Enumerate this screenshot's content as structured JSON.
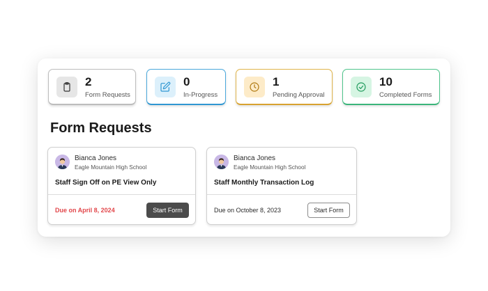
{
  "stats": [
    {
      "value": "2",
      "label": "Form Requests",
      "icon": "clipboard-icon",
      "color": "#bdbdbd"
    },
    {
      "value": "0",
      "label": "In-Progress",
      "icon": "edit-icon",
      "color": "#2f97d2"
    },
    {
      "value": "1",
      "label": "Pending Approval",
      "icon": "clock-icon",
      "color": "#d8a22f"
    },
    {
      "value": "10",
      "label": "Completed Forms",
      "icon": "check-circle-icon",
      "color": "#3bb57a"
    }
  ],
  "section_title": "Form Requests",
  "cards": [
    {
      "user_name": "Bianca Jones",
      "school": "Eagle Mountain High School",
      "form_title": "Staff Sign Off on PE View Only",
      "due": "Due on April 8, 2024",
      "due_color": "#e2474b",
      "button_label": "Start Form"
    },
    {
      "user_name": "Bianca Jones",
      "school": "Eagle Mountain High School",
      "form_title": "Staff Monthly Transaction Log",
      "due": "Due on October 8, 2023",
      "button_label": "Start Form"
    }
  ]
}
